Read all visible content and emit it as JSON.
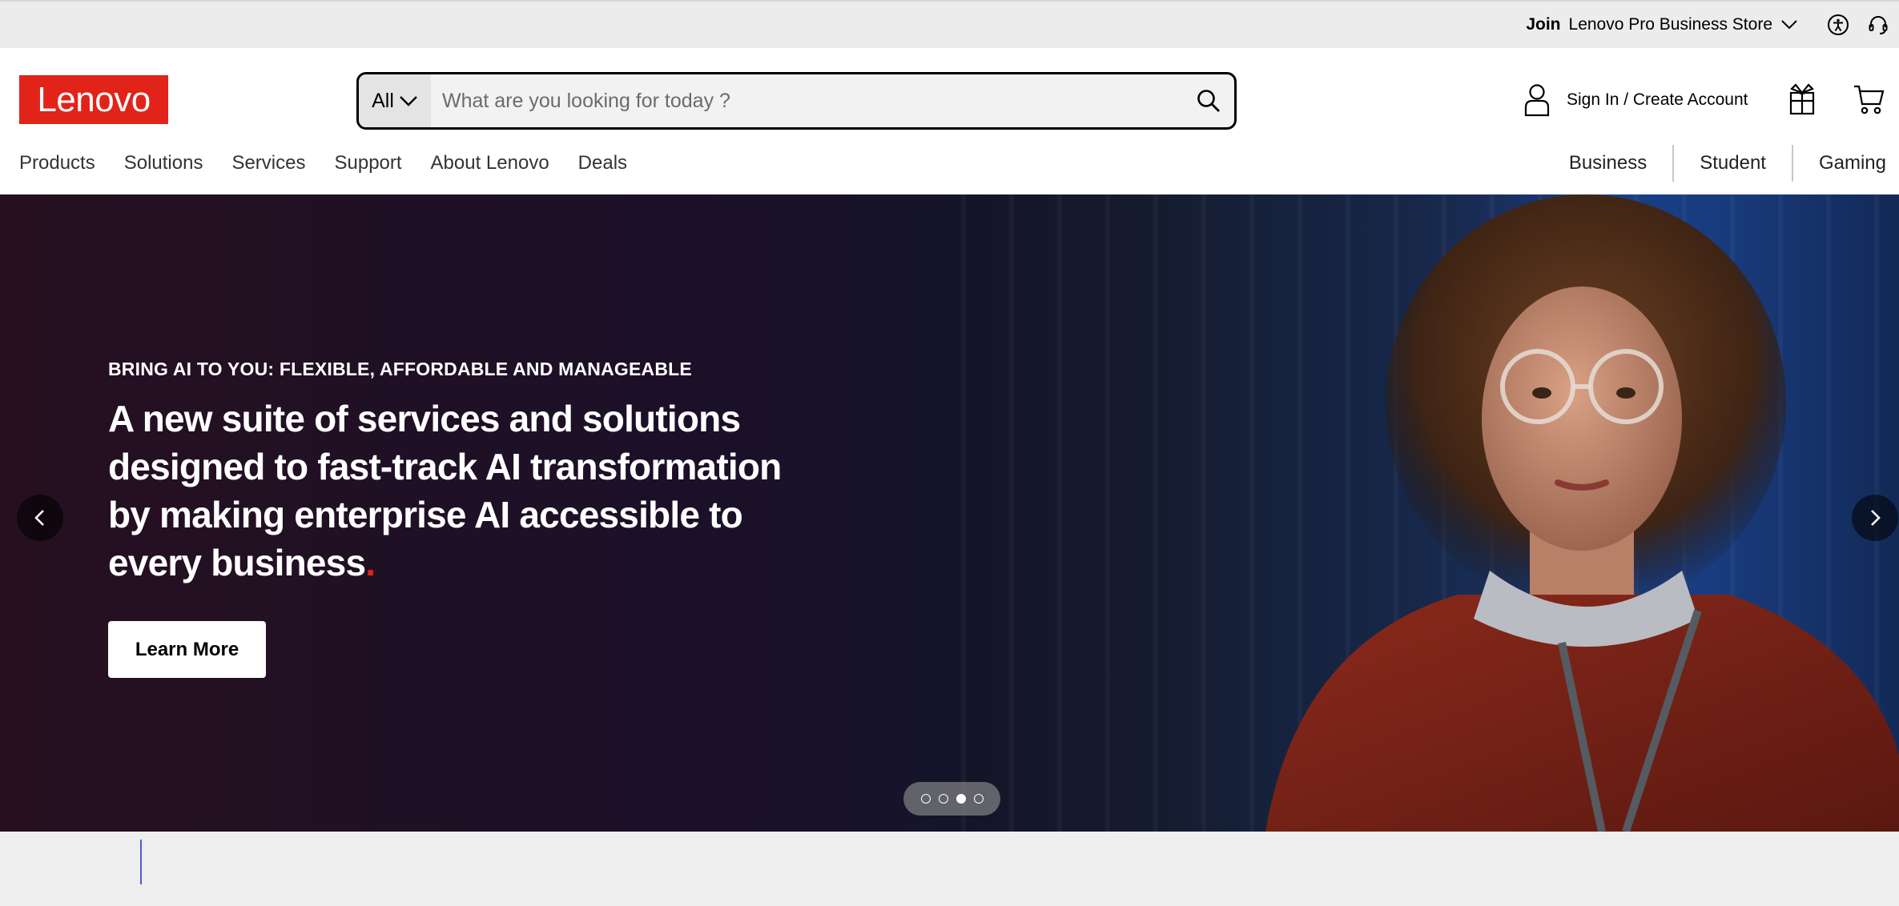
{
  "utility_bar": {
    "join_label": "Join",
    "store_label": "Lenovo Pro Business Store"
  },
  "header": {
    "logo_text": "Lenovo",
    "search": {
      "category": "All",
      "placeholder": "What are you looking for today ?",
      "value": ""
    },
    "account_label": "Sign In / Create Account"
  },
  "main_nav": {
    "items": [
      {
        "label": "Products"
      },
      {
        "label": "Solutions"
      },
      {
        "label": "Services"
      },
      {
        "label": "Support"
      },
      {
        "label": "About Lenovo"
      },
      {
        "label": "Deals"
      }
    ]
  },
  "segment_nav": {
    "items": [
      {
        "label": "Business"
      },
      {
        "label": "Student"
      },
      {
        "label": "Gaming"
      }
    ]
  },
  "hero": {
    "eyebrow": "BRING AI TO YOU: FLEXIBLE, AFFORDABLE AND MANAGEABLE",
    "headline": "A new suite of services and solutions designed to fast-track AI transformation by making enterprise AI accessible to every business",
    "headline_dot": ".",
    "cta_label": "Learn More",
    "slide_count": 4,
    "active_slide": 3
  },
  "colors": {
    "brand_red": "#e2231a",
    "utility_bg": "#ececec",
    "strip_bg": "#eeeeee"
  },
  "icons": [
    "chevron-down-icon",
    "accessibility-icon",
    "headset-icon",
    "search-icon",
    "user-icon",
    "gift-icon",
    "cart-icon",
    "chevron-left-icon",
    "chevron-right-icon"
  ]
}
